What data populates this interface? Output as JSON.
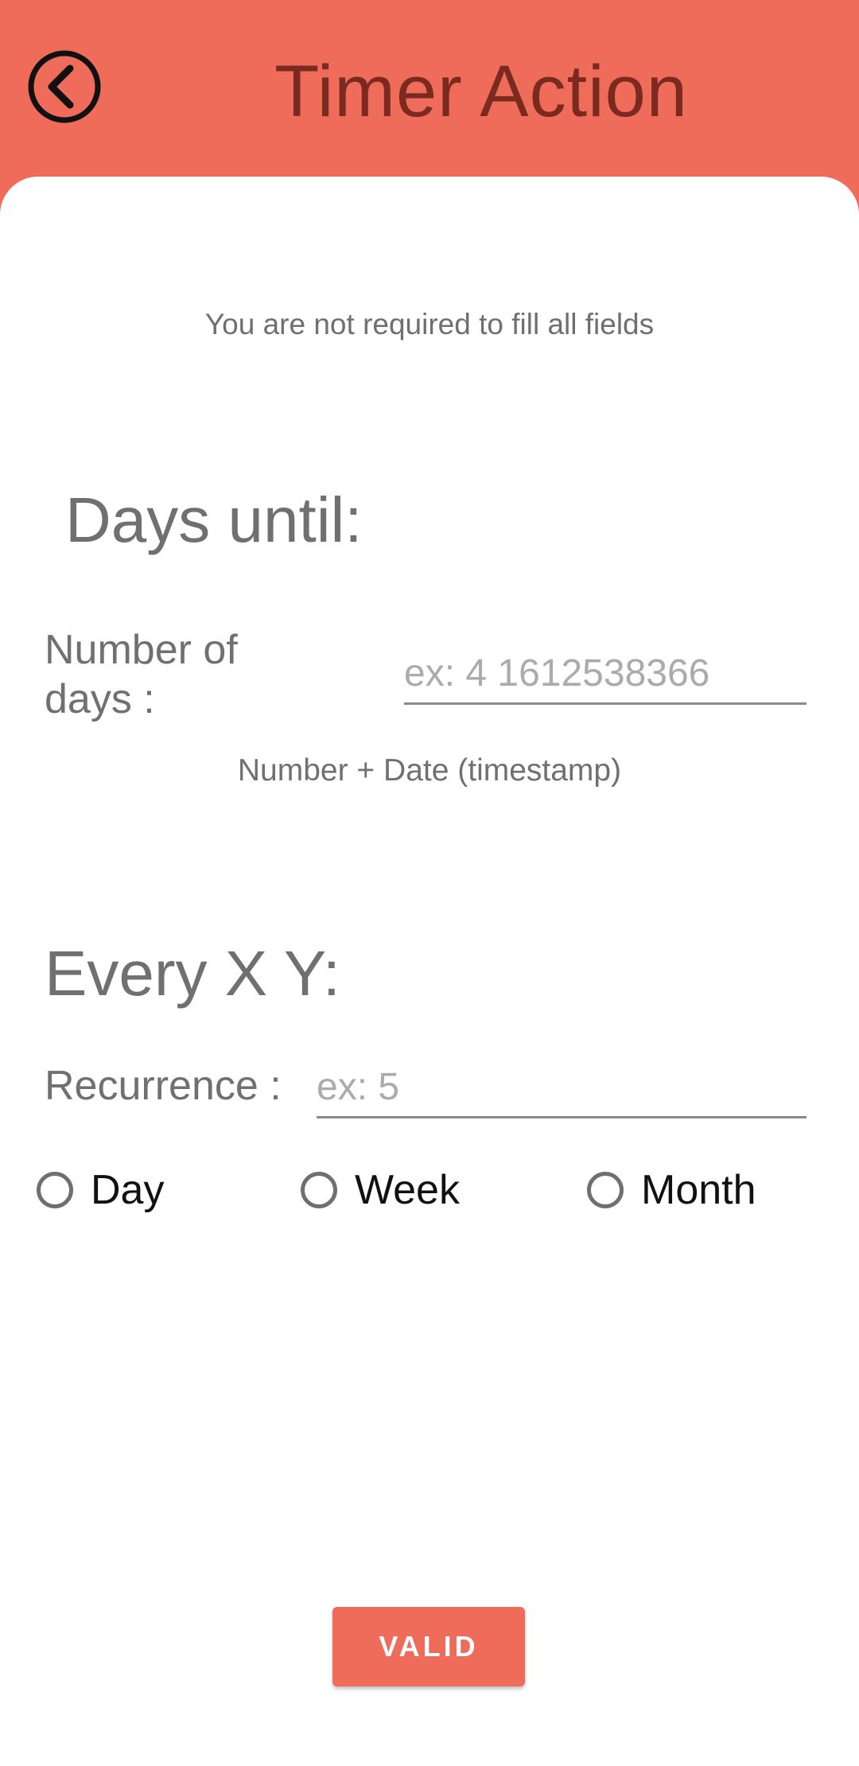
{
  "header": {
    "title": "Timer Action",
    "back_icon": "chevron-left-circle-icon",
    "background_color": "#ef6c5a",
    "title_color": "#7a2a1f"
  },
  "form": {
    "hint": "You are not required to fill all fields",
    "days_until": {
      "title": "Days until:",
      "label": "Number of days :",
      "value": "",
      "placeholder": "ex: 4 1612538366",
      "help": "Number + Date (timestamp)"
    },
    "every": {
      "title": "Every X Y:",
      "label": "Recurrence :",
      "value": "",
      "placeholder": "ex: 5",
      "options": [
        {
          "label": "Day",
          "selected": false
        },
        {
          "label": "Week",
          "selected": false
        },
        {
          "label": "Month",
          "selected": false
        }
      ]
    },
    "submit_label": "VALID",
    "accent_color": "#ef6c5a"
  }
}
